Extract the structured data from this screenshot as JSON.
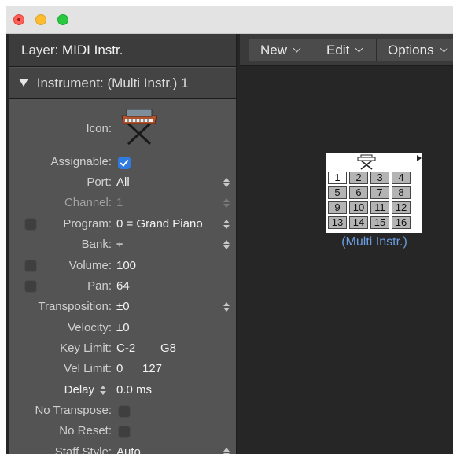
{
  "window": {
    "controls": [
      "close",
      "minimize",
      "zoom"
    ]
  },
  "inspector": {
    "layer_label": "Layer:",
    "layer_value": "MIDI Instr.",
    "instrument_label": "Instrument:",
    "instrument_value": "(Multi Instr.) 1",
    "icon_label": "Icon:",
    "icon_name": "keyboard-stand-icon",
    "rows": {
      "assignable": {
        "label": "Assignable:",
        "checked": true
      },
      "port": {
        "label": "Port:",
        "value": "All"
      },
      "channel": {
        "label": "Channel:",
        "value": "1"
      },
      "program": {
        "label": "Program:",
        "value": "0 = Grand Piano"
      },
      "bank": {
        "label": "Bank:",
        "value": "÷"
      },
      "volume": {
        "label": "Volume:",
        "value": "100"
      },
      "pan": {
        "label": "Pan:",
        "value": "64"
      },
      "transposition": {
        "label": "Transposition:",
        "value": "±0"
      },
      "velocity": {
        "label": "Velocity:",
        "value": "±0"
      },
      "key_limit": {
        "label": "Key Limit:",
        "low": "C-2",
        "high": "G8"
      },
      "vel_limit": {
        "label": "Vel Limit:",
        "low": "0",
        "high": "127"
      },
      "delay": {
        "label": "Delay",
        "value": "0.0 ms"
      },
      "no_transpose": {
        "label": "No Transpose:"
      },
      "no_reset": {
        "label": "No Reset:"
      },
      "staff_style": {
        "label": "Staff Style:",
        "value": "Auto"
      }
    }
  },
  "toolbar": {
    "new": "New",
    "edit": "Edit",
    "options": "Options"
  },
  "multi_instrument": {
    "label": "(Multi Instr.)",
    "channels": [
      "1",
      "2",
      "3",
      "4",
      "5",
      "6",
      "7",
      "8",
      "9",
      "10",
      "11",
      "12",
      "13",
      "14",
      "15",
      "16"
    ],
    "selected_channel": "1"
  },
  "colors": {
    "accent": "#2f7be0",
    "object_label": "#6b9ee0"
  }
}
